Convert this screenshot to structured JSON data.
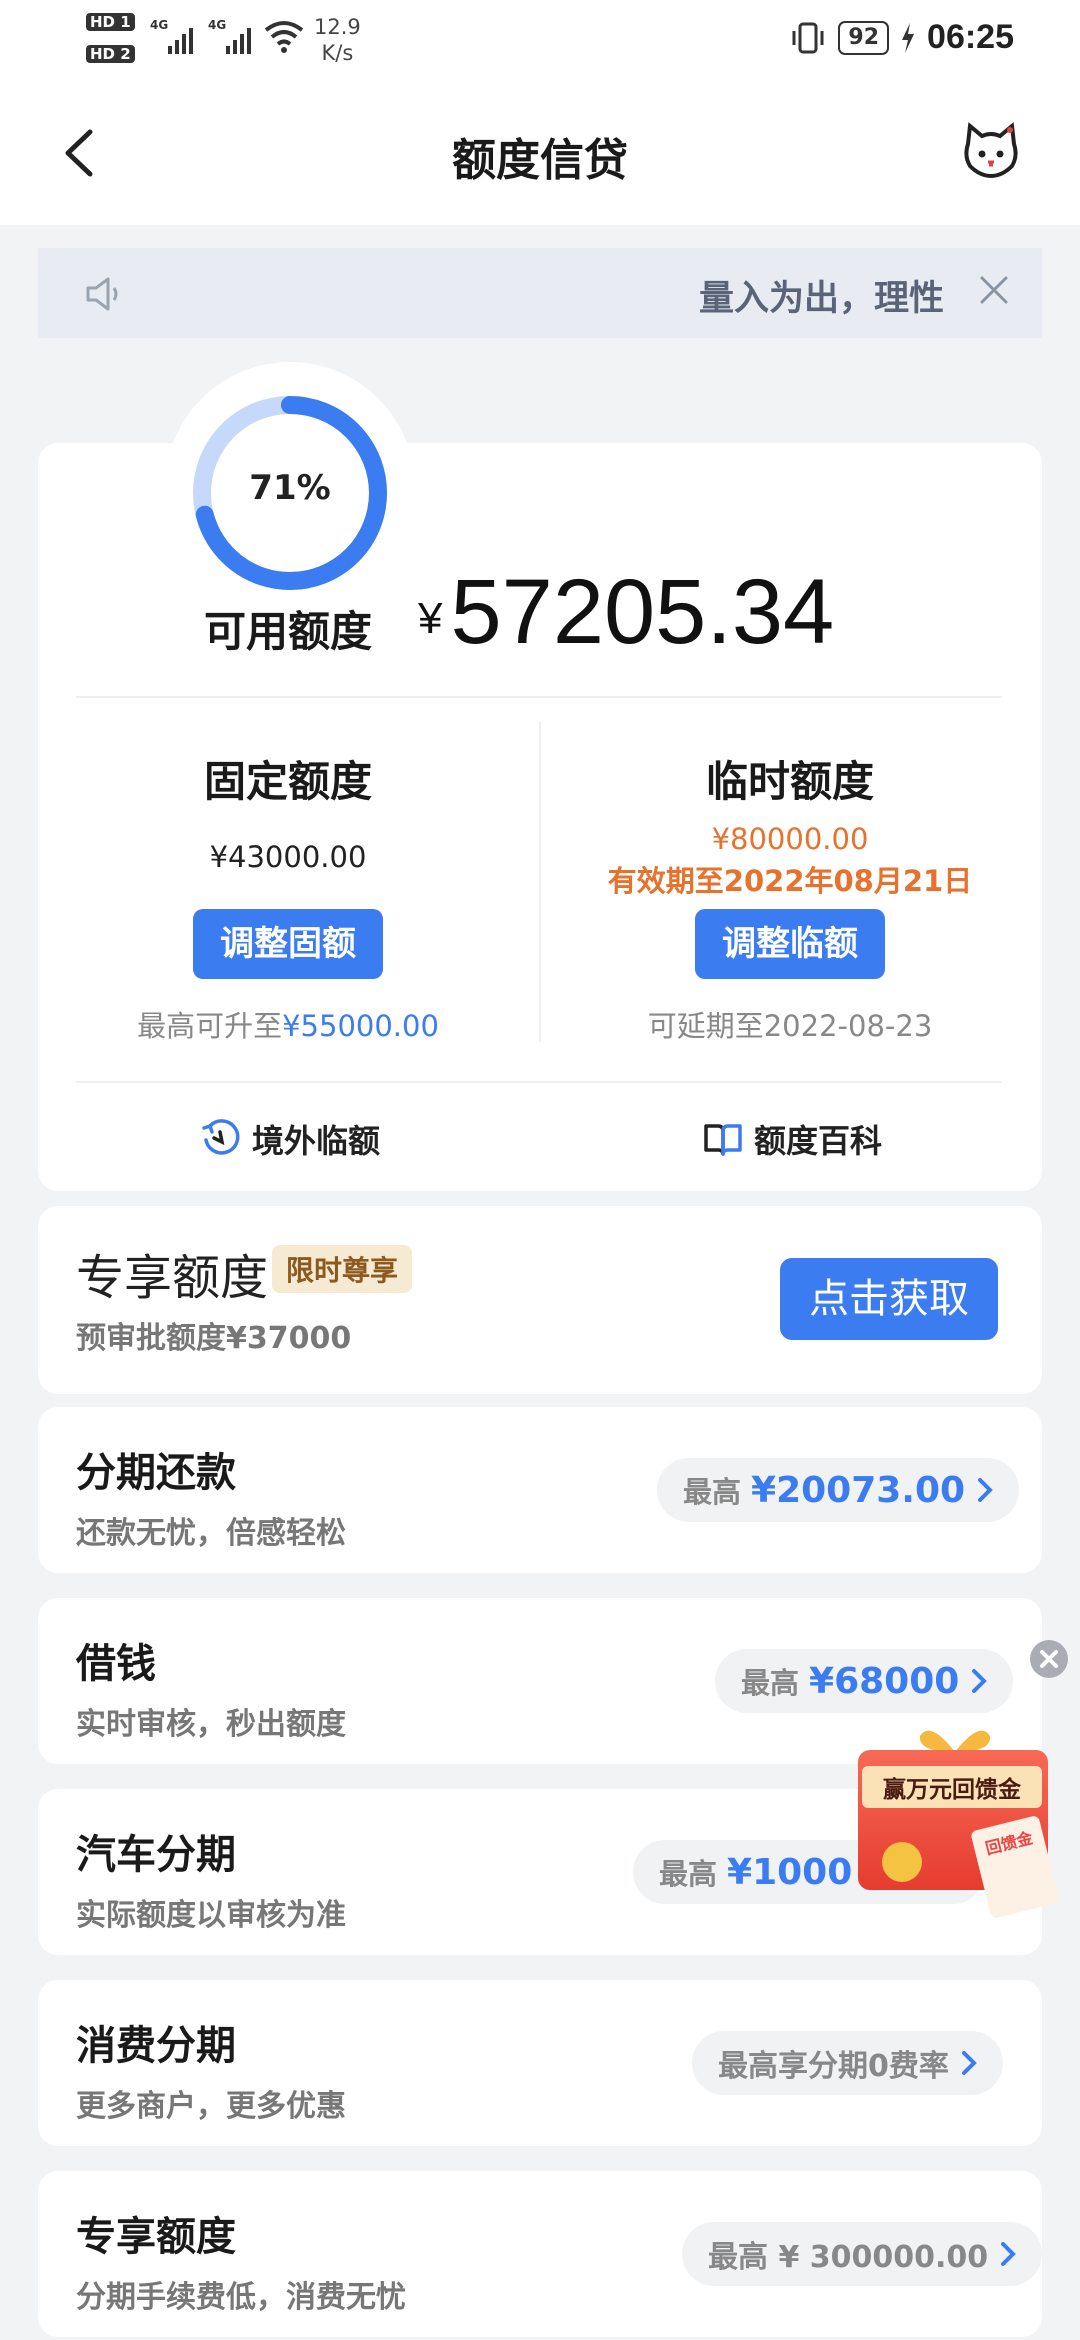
{
  "status_bar": {
    "hd1": "HD 1",
    "hd2": "HD 2",
    "net1": "4G",
    "net2": "4G",
    "speed_value": "12.9",
    "speed_unit": "K/s",
    "battery": "92",
    "time": "06:25"
  },
  "nav": {
    "title": "额度信贷",
    "back_icon": "chevron-left-icon",
    "mascot_icon": "cat-mascot-icon"
  },
  "notice": {
    "text": "量入为出，理性",
    "speaker_icon": "speaker-icon",
    "close_icon": "close-icon"
  },
  "credit": {
    "usage_percent": 71,
    "usage_label": "71%",
    "available_label": "可用额度",
    "currency": "¥",
    "available_amount": "57205.34",
    "fixed": {
      "title": "固定额度",
      "amount": "¥43000.00",
      "button": "调整固额",
      "note_prefix": "最高可升至",
      "note_value": "¥55000.00"
    },
    "temp": {
      "title": "临时额度",
      "amount": "¥80000.00",
      "validity": "有效期至2022年08月21日",
      "button": "调整临额",
      "note_prefix": "可延期至",
      "note_value": "2022-08-23"
    },
    "links": [
      {
        "label": "境外临额",
        "icon": "overseas-clock-icon"
      },
      {
        "label": "额度百科",
        "icon": "book-icon"
      }
    ]
  },
  "exclusive": {
    "title": "专享额度",
    "tag": "限时尊享",
    "subtitle": "预审批额度¥37000",
    "button": "点击获取"
  },
  "products": [
    {
      "title": "分期还款",
      "subtitle": "还款无忧，倍感轻松",
      "pill_label": "最高",
      "pill_value": "¥20073.00"
    },
    {
      "title": "借钱",
      "subtitle": "实时审核，秒出额度",
      "pill_label": "最高",
      "pill_value": "¥68000"
    },
    {
      "title": "汽车分期",
      "subtitle": "实际额度以审核为准",
      "pill_label": "最高",
      "pill_value": "¥1000"
    },
    {
      "title": "消费分期",
      "subtitle": "更多商户，更多优惠",
      "pill_label": "",
      "pill_value": "最高享分期0费率"
    },
    {
      "title": "专享额度",
      "subtitle": "分期手续费低，消费无忧",
      "pill_label": "",
      "pill_value": "最高 ¥ 300000.00"
    }
  ],
  "promo": {
    "text": "赢万元回馈金",
    "envelope_text": "回馈金",
    "close_icon": "close-icon"
  },
  "colors": {
    "accent": "#3b7cf0",
    "orange": "#e8722c",
    "ring_light": "#c6d9fb",
    "background": "#f2f3f5"
  }
}
